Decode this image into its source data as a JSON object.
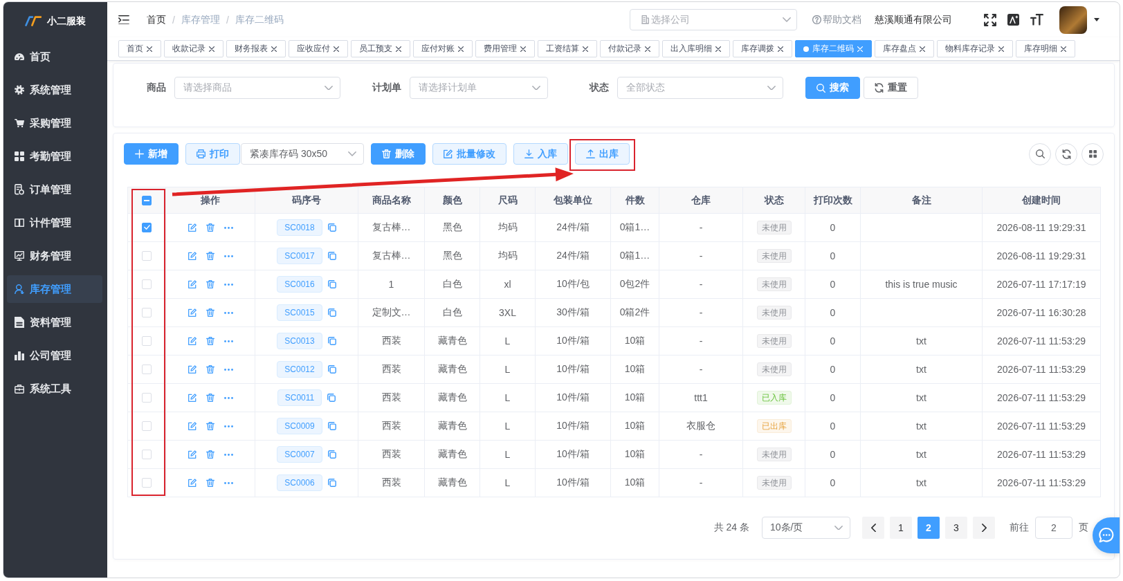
{
  "sidebar": {
    "logo_text": "小二服装",
    "items": [
      {
        "label": "首页",
        "selected": false
      },
      {
        "label": "系统管理",
        "selected": false
      },
      {
        "label": "采购管理",
        "selected": false
      },
      {
        "label": "考勤管理",
        "selected": false
      },
      {
        "label": "订单管理",
        "selected": false
      },
      {
        "label": "计件管理",
        "selected": false
      },
      {
        "label": "财务管理",
        "selected": false
      },
      {
        "label": "库存管理",
        "selected": true
      },
      {
        "label": "资料管理",
        "selected": false
      },
      {
        "label": "公司管理",
        "selected": false
      },
      {
        "label": "系统工具",
        "selected": false
      }
    ]
  },
  "header": {
    "breadcrumb": [
      {
        "label": "首页",
        "link": true
      },
      {
        "separator": "/",
        "label": "库存管理",
        "link": false
      },
      {
        "separator": "/",
        "label": "库存二维码",
        "link": false
      }
    ],
    "company_select": {
      "placeholder": "选择公司"
    },
    "help_link": "帮助文档",
    "company_name": "慈溪顺通有限公司"
  },
  "tabs": [
    {
      "label": "首页",
      "selected": false
    },
    {
      "label": "收款记录",
      "selected": false
    },
    {
      "label": "财务报表",
      "selected": false
    },
    {
      "label": "应收应付",
      "selected": false
    },
    {
      "label": "员工预支",
      "selected": false
    },
    {
      "label": "应付对账",
      "selected": false
    },
    {
      "label": "费用管理",
      "selected": false
    },
    {
      "label": "工资结算",
      "selected": false
    },
    {
      "label": "付款记录",
      "selected": false
    },
    {
      "label": "出入库明细",
      "selected": false
    },
    {
      "label": "库存调拨",
      "selected": false
    },
    {
      "label": "库存二维码",
      "selected": true
    },
    {
      "label": "库存盘点",
      "selected": false
    },
    {
      "label": "物料库存记录",
      "selected": false
    },
    {
      "label": "库存明细",
      "selected": false
    }
  ],
  "search_form": {
    "fields": [
      {
        "label": "商品",
        "placeholder": "请选择商品"
      },
      {
        "label": "计划单",
        "placeholder": "请选择计划单"
      },
      {
        "label": "状态",
        "placeholder": "全部状态"
      }
    ],
    "buttons": [
      {
        "kind": "primary",
        "label": "搜索"
      },
      {
        "kind": "default",
        "label": "重置"
      }
    ]
  },
  "toolbar": {
    "buttons": [
      {
        "kind": "primary",
        "label": "新增",
        "highlighted": false
      },
      {
        "kind": "plain",
        "label": "打印",
        "highlighted": false
      },
      {
        "kind": "select",
        "value": "紧凑库存码 30x50",
        "highlighted": false
      },
      {
        "kind": "primary",
        "label": "删除",
        "highlighted": false
      },
      {
        "kind": "plain",
        "label": "批量修改",
        "highlighted": false
      },
      {
        "kind": "plain",
        "label": "入库",
        "highlighted": false
      },
      {
        "kind": "plain",
        "label": "出库",
        "highlighted": true
      }
    ]
  },
  "table": {
    "select_column_highlighted": true,
    "header_checkbox": {
      "indeterminate": true
    },
    "columns": [
      "操作",
      "码序号",
      "商品名称",
      "颜色",
      "尺码",
      "包装单位",
      "件数",
      "仓库",
      "状态",
      "打印次数",
      "备注",
      "创建时间"
    ],
    "rows": [
      {
        "selected": true,
        "code": "SC0018",
        "product": "复古棒…",
        "product_color": "黑色",
        "size": "均码",
        "package_unit": "24件/箱",
        "quantity": "0箱1…",
        "warehouse": "-",
        "status": {
          "text": "未使用",
          "kind": "info"
        },
        "print_count": "0",
        "created_at": "2026-08-11 19:29:31"
      },
      {
        "selected": false,
        "code": "SC0017",
        "product": "复古棒…",
        "product_color": "黑色",
        "size": "均码",
        "package_unit": "24件/箱",
        "quantity": "0箱1…",
        "warehouse": "-",
        "status": {
          "text": "未使用",
          "kind": "info"
        },
        "print_count": "0",
        "created_at": "2026-08-11 19:29:31"
      },
      {
        "selected": false,
        "code": "SC0016",
        "product": "1",
        "product_color": "白色",
        "size": "xl",
        "package_unit": "10件/包",
        "quantity": "0包2件",
        "warehouse": "-",
        "status": {
          "text": "未使用",
          "kind": "info"
        },
        "print_count": "0",
        "remark": "this is true music",
        "created_at": "2026-07-11 17:17:19"
      },
      {
        "selected": false,
        "code": "SC0015",
        "product": "定制文…",
        "product_color": "白色",
        "size": "3XL",
        "package_unit": "30件/箱",
        "quantity": "0箱2件",
        "warehouse": "-",
        "status": {
          "text": "未使用",
          "kind": "info"
        },
        "print_count": "0",
        "created_at": "2026-07-11 16:30:28"
      },
      {
        "selected": false,
        "code": "SC0013",
        "product": "西装",
        "product_color": "藏青色",
        "size": "L",
        "package_unit": "10件/箱",
        "quantity": "10箱",
        "warehouse": "-",
        "status": {
          "text": "未使用",
          "kind": "info"
        },
        "print_count": "0",
        "remark": "txt",
        "created_at": "2026-07-11 11:53:29"
      },
      {
        "selected": false,
        "code": "SC0012",
        "product": "西装",
        "product_color": "藏青色",
        "size": "L",
        "package_unit": "10件/箱",
        "quantity": "10箱",
        "warehouse": "-",
        "status": {
          "text": "未使用",
          "kind": "info"
        },
        "print_count": "0",
        "remark": "txt",
        "created_at": "2026-07-11 11:53:29"
      },
      {
        "selected": false,
        "code": "SC0011",
        "product": "西装",
        "product_color": "藏青色",
        "size": "L",
        "package_unit": "10件/箱",
        "quantity": "10箱",
        "warehouse": "ttt1",
        "status": {
          "text": "已入库",
          "kind": "success"
        },
        "print_count": "0",
        "remark": "txt",
        "created_at": "2026-07-11 11:53:29"
      },
      {
        "selected": false,
        "code": "SC0009",
        "product": "西装",
        "product_color": "藏青色",
        "size": "L",
        "package_unit": "10件/箱",
        "quantity": "10箱",
        "warehouse": "衣服仓",
        "status": {
          "text": "已出库",
          "kind": "warning"
        },
        "print_count": "0",
        "remark": "txt",
        "created_at": "2026-07-11 11:53:29"
      },
      {
        "selected": false,
        "code": "SC0007",
        "product": "西装",
        "product_color": "藏青色",
        "size": "L",
        "package_unit": "10件/箱",
        "quantity": "10箱",
        "warehouse": "-",
        "status": {
          "text": "未使用",
          "kind": "info"
        },
        "print_count": "0",
        "remark": "txt",
        "created_at": "2026-07-11 11:53:29"
      },
      {
        "selected": false,
        "code": "SC0006",
        "product": "西装",
        "product_color": "藏青色",
        "size": "L",
        "package_unit": "10件/箱",
        "quantity": "10箱",
        "warehouse": "-",
        "status": {
          "text": "未使用",
          "kind": "info"
        },
        "print_count": "0",
        "remark": "txt",
        "created_at": "2026-07-11 11:53:29"
      }
    ]
  },
  "pagination": {
    "total": "共 24 条",
    "page_size": "10条/页",
    "pages": [
      {
        "label": "1",
        "selected": false
      },
      {
        "label": "2",
        "selected": true
      },
      {
        "label": "3",
        "selected": false
      }
    ],
    "goto_label": "前往",
    "goto_value": "2",
    "goto_suffix": "页"
  },
  "annotation_arrow": true
}
